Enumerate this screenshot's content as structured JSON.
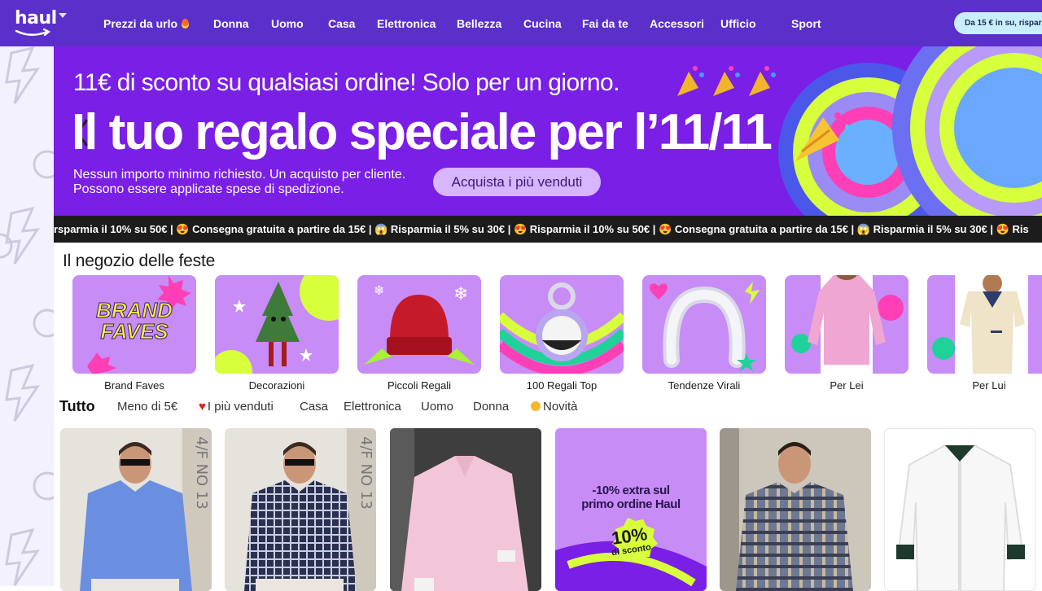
{
  "nav": {
    "logo_text": "haul",
    "links": [
      "Prezzi da urlo",
      "Donna",
      "Uomo",
      "Casa",
      "Elettronica",
      "Bellezza",
      "Cucina",
      "Fai da te",
      "Accessori",
      "Ufficio",
      "Sport"
    ],
    "promo_pill": "Da 15 € in su, rispar"
  },
  "banner": {
    "line1": "11€ di sconto su qualsiasi ordine! Solo per un giorno.",
    "title": "Il tuo regalo speciale per l’11/11",
    "small_line1": "Nessun importo minimo richiesto. Un acquisto per cliente.",
    "small_line2": "Possono essere applicate spese di spedizione.",
    "cta": "Acquista i più venduti"
  },
  "ticker": {
    "text": "rsparmia il 10% su 50€ | 😍 Consegna gratuita a partire da 15€ | 😱 Risparmia il 5% su 30€ | 😍 Risparmia il 10% su 50€ | 😍 Consegna gratuita a partire da 15€ | 😱 Risparmia il 5% su 30€ | 😍 Ris"
  },
  "section": {
    "title": "Il negozio delle feste",
    "categories": [
      {
        "label": "Brand Faves",
        "img_text_1": "BRAND",
        "img_text_2": "FAVES"
      },
      {
        "label": "Decorazioni"
      },
      {
        "label": "Piccoli Regali"
      },
      {
        "label": "100 Regali Top"
      },
      {
        "label": "Tendenze Virali"
      },
      {
        "label": "Per Lei"
      },
      {
        "label": "Per Lui"
      }
    ]
  },
  "tabs": {
    "items": [
      "Tutto",
      "Meno di 5€",
      "I più venduti",
      "Casa",
      "Elettronica",
      "Uomo",
      "Donna",
      "Novità"
    ]
  },
  "products": {
    "promo_line1": "-10% extra sul",
    "promo_line2": "primo ordine Haul",
    "promo_badge_1": "10%",
    "promo_badge_2": "di sconto",
    "sign_text": "4/F NO 13"
  },
  "colors": {
    "nav_bg": "#5b2fc9",
    "banner_bg": "#7a1fe6",
    "category_bg": "#c88cf6",
    "cta_bg": "#d7b5ff",
    "ticker_bg": "#1c1c1c",
    "pill_bg": "#c9efff"
  }
}
